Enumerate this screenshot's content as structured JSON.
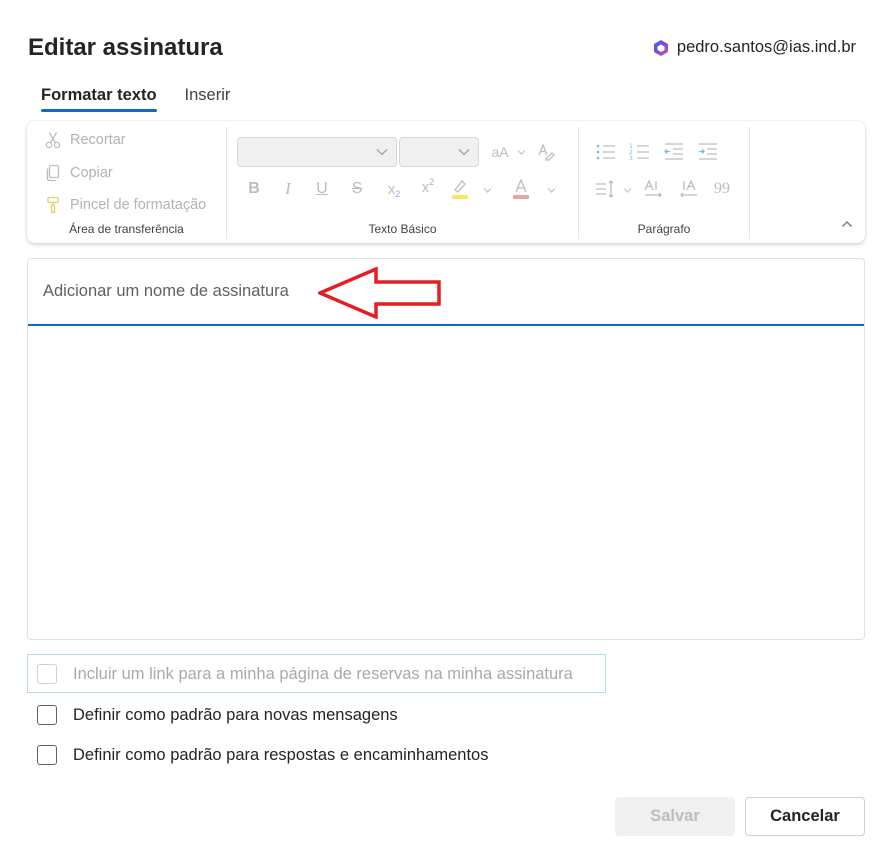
{
  "dialog": {
    "title": "Editar assinatura",
    "account": "pedro.santos@ias.ind.br"
  },
  "tabs": [
    {
      "label": "Formatar texto",
      "active": true
    },
    {
      "label": "Inserir",
      "active": false
    }
  ],
  "ribbon": {
    "clipboard": {
      "label": "Área de transferência",
      "cut": "Recortar",
      "copy": "Copiar",
      "format_painter": "Pincel de formatação"
    },
    "basic_text": {
      "label": "Texto Básico"
    },
    "paragraph": {
      "label": "Parágrafo"
    }
  },
  "editor": {
    "name_placeholder": "Adicionar um nome de assinatura"
  },
  "options": {
    "booking_link": "Incluir um link para a minha página de reservas na minha assinatura",
    "default_new": "Definir como padrão para novas mensagens",
    "default_replies": "Definir como padrão para respostas e encaminhamentos"
  },
  "buttons": {
    "save": "Salvar",
    "cancel": "Cancelar"
  },
  "colors": {
    "accent": "#0f6cbd",
    "arrow": "#e31e24",
    "highlight": "#f7ea5e",
    "font_color": "#e8a3a3"
  }
}
